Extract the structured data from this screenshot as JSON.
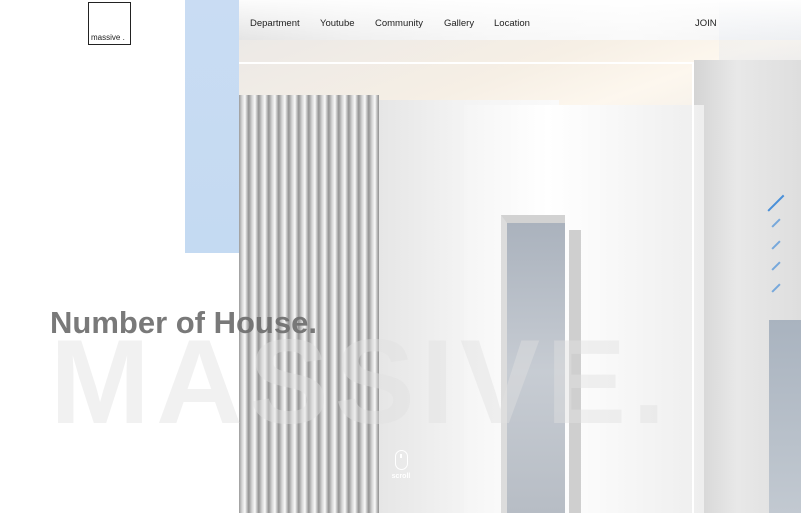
{
  "logo": {
    "text": "massive ."
  },
  "nav": {
    "items": [
      "Department",
      "Youtube",
      "Community",
      "Gallery",
      "Location"
    ],
    "join": "JOIN"
  },
  "hero": {
    "heading": "Number of House.",
    "watermark": "MASSIVE.",
    "scroll_label": "scroll"
  },
  "pager": {
    "count": 5,
    "active_index": 0
  },
  "colors": {
    "accent_blue": "#4a90d9",
    "panel_blue": "#c9dcf3"
  }
}
